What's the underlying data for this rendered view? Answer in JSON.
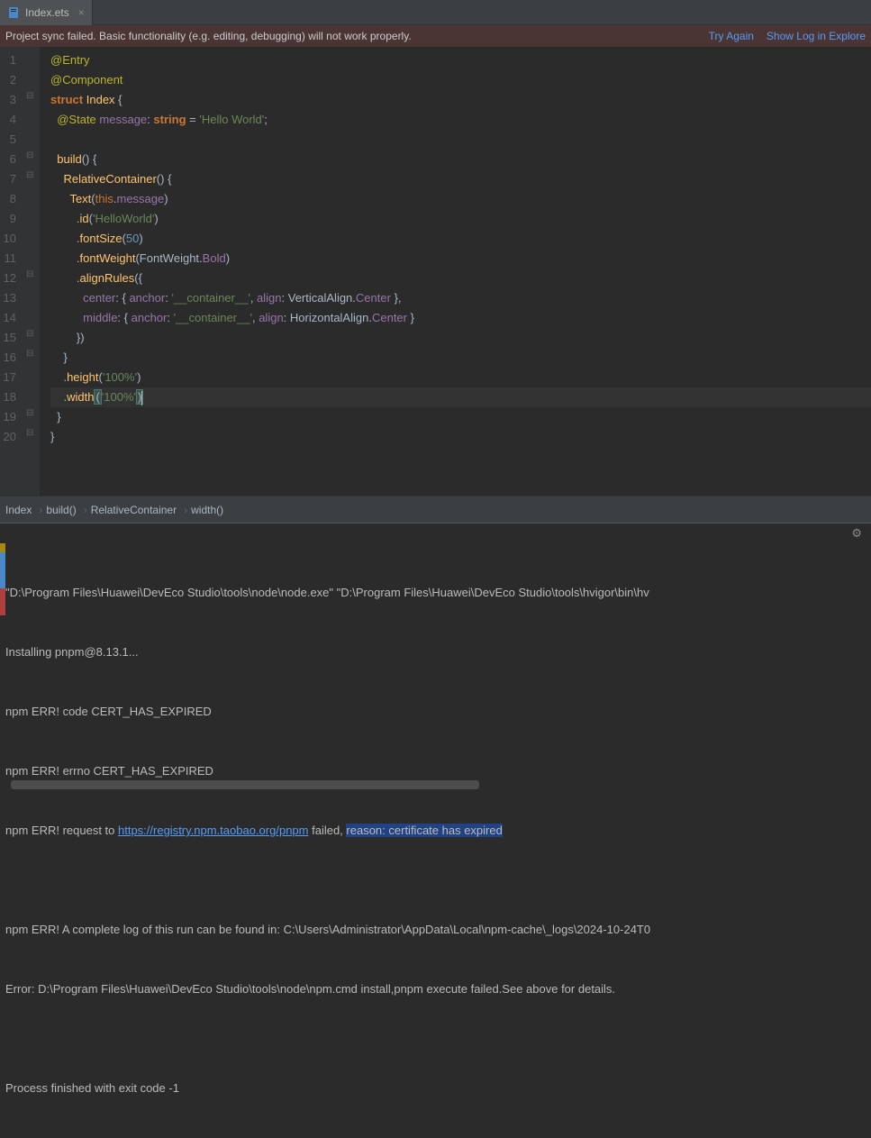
{
  "tabs": {
    "active": {
      "label": "Index.ets"
    }
  },
  "syncBanner": {
    "message": "Project sync failed. Basic functionality (e.g. editing, debugging) will not work properly.",
    "tryAgain": "Try Again",
    "showLog": "Show Log in Explore"
  },
  "gutter": {
    "lines": [
      "1",
      "2",
      "3",
      "4",
      "5",
      "6",
      "7",
      "8",
      "9",
      "10",
      "11",
      "12",
      "13",
      "14",
      "15",
      "16",
      "17",
      "18",
      "19",
      "20"
    ]
  },
  "code": {
    "l1": {
      "entry": "@Entry"
    },
    "l2": {
      "component": "@Component"
    },
    "l3": {
      "struct": "struct",
      "name": "Index",
      "brace": " {"
    },
    "l4": {
      "state": "@State",
      "msg": " message",
      "colon": ": ",
      "type": "string",
      "eq": " = ",
      "str": "'Hello World'",
      "semi": ";"
    },
    "l6": {
      "build": "build",
      "parens": "()",
      "brace": " {"
    },
    "l7": {
      "rc": "RelativeContainer",
      "parens": "()",
      "brace": " {"
    },
    "l8": {
      "text": "Text",
      "open": "(",
      "this": "this",
      "dot": ".",
      "msg": "message",
      "close": ")"
    },
    "l9": {
      "dot": ".",
      "method": "id",
      "open": "(",
      "str": "'HelloWorld'",
      "close": ")"
    },
    "l10": {
      "dot": ".",
      "method": "fontSize",
      "open": "(",
      "num": "50",
      "close": ")"
    },
    "l11": {
      "dot": ".",
      "method": "fontWeight",
      "open": "(",
      "fw": "FontWeight",
      "dot2": ".",
      "bold": "Bold",
      "close": ")"
    },
    "l12": {
      "dot": ".",
      "method": "alignRules",
      "open": "({"
    },
    "l13": {
      "key": "center",
      "colon": ": { ",
      "anchor": "anchor",
      "colon2": ": ",
      "str": "'__container__'",
      "comma": ", ",
      "align": "align",
      "colon3": ": ",
      "va": "VerticalAlign",
      "dot": ".",
      "ctr": "Center",
      "close": " },"
    },
    "l14": {
      "key": "middle",
      "colon": ": { ",
      "anchor": "anchor",
      "colon2": ": ",
      "str": "'__container__'",
      "comma": ", ",
      "align": "align",
      "colon3": ": ",
      "ha": "HorizontalAlign",
      "dot": ".",
      "ctr": "Center",
      "close": " }"
    },
    "l15": {
      "close": "})"
    },
    "l16": {
      "brace": "}"
    },
    "l17": {
      "dot": ".",
      "method": "height",
      "open": "(",
      "str": "'100%'",
      "close": ")"
    },
    "l18": {
      "dot": ".",
      "method": "width",
      "open": "(",
      "str": "'100%'",
      "close": ")"
    },
    "l19": {
      "brace": "}"
    },
    "l20": {
      "brace": "}"
    }
  },
  "breadcrumbs": {
    "items": [
      "Index",
      "build()",
      "RelativeContainer",
      "width()"
    ]
  },
  "console": {
    "l1": "\"D:\\Program Files\\Huawei\\DevEco Studio\\tools\\node\\node.exe\" \"D:\\Program Files\\Huawei\\DevEco Studio\\tools\\hvigor\\bin\\hv",
    "l2": "Installing pnpm@8.13.1...",
    "l3": "npm ERR! code CERT_HAS_EXPIRED",
    "l4": "npm ERR! errno CERT_HAS_EXPIRED",
    "l5a": "npm ERR! request to ",
    "l5link": "https://registry.npm.taobao.org/pnpm",
    "l5b": " failed, ",
    "l5sel": "reason: certificate has expired",
    "l7": "npm ERR! A complete log of this run can be found in: C:\\Users\\Administrator\\AppData\\Local\\npm-cache\\_logs\\2024-10-24T0",
    "l8": "Error: D:\\Program Files\\Huawei\\DevEco Studio\\tools\\node\\npm.cmd install,pnpm execute failed.See above for details.",
    "l10": "Process finished with exit code -1"
  }
}
